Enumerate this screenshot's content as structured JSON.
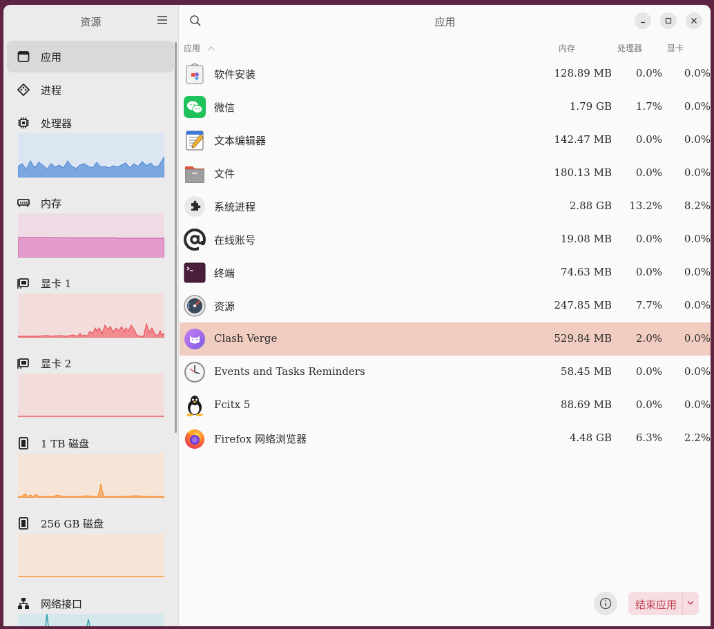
{
  "sidebar": {
    "title": "资源",
    "items": [
      {
        "label": "应用",
        "icon": "app-window-icon"
      },
      {
        "label": "进程",
        "icon": "process-icon"
      },
      {
        "label": "处理器",
        "icon": "cpu-icon"
      },
      {
        "label": "内存",
        "icon": "memory-icon"
      },
      {
        "label": "显卡 1",
        "icon": "gpu-icon"
      },
      {
        "label": "显卡 2",
        "icon": "gpu-icon"
      },
      {
        "label": "1 TB 磁盘",
        "icon": "drive-icon"
      },
      {
        "label": "256 GB 磁盘",
        "icon": "drive-icon"
      },
      {
        "label": "网络接口",
        "icon": "network-icon"
      }
    ]
  },
  "header": {
    "title": "应用"
  },
  "columns": {
    "app": "应用",
    "memory": "内存",
    "cpu": "处理器",
    "gpu": "显卡"
  },
  "apps": [
    {
      "name": "软件安装",
      "memory": "128.89 MB",
      "cpu": "0.0%",
      "gpu": "0.0%",
      "icon": "software-install-icon"
    },
    {
      "name": "微信",
      "memory": "1.79 GB",
      "cpu": "1.7%",
      "gpu": "0.0%",
      "icon": "wechat-icon"
    },
    {
      "name": "文本编辑器",
      "memory": "142.47 MB",
      "cpu": "0.0%",
      "gpu": "0.0%",
      "icon": "text-editor-icon"
    },
    {
      "name": "文件",
      "memory": "180.13 MB",
      "cpu": "0.0%",
      "gpu": "0.0%",
      "icon": "files-icon"
    },
    {
      "name": "系统进程",
      "memory": "2.88 GB",
      "cpu": "13.2%",
      "gpu": "8.2%",
      "icon": "system-process-icon"
    },
    {
      "name": "在线账号",
      "memory": "19.08 MB",
      "cpu": "0.0%",
      "gpu": "0.0%",
      "icon": "online-accounts-icon"
    },
    {
      "name": "终端",
      "memory": "74.63 MB",
      "cpu": "0.0%",
      "gpu": "0.0%",
      "icon": "terminal-icon"
    },
    {
      "name": "资源",
      "memory": "247.85 MB",
      "cpu": "7.7%",
      "gpu": "0.0%",
      "icon": "resources-icon"
    },
    {
      "name": "Clash Verge",
      "memory": "529.84 MB",
      "cpu": "2.0%",
      "gpu": "0.0%",
      "icon": "clash-verge-icon",
      "selected": true
    },
    {
      "name": "Events and Tasks Reminders",
      "memory": "58.45 MB",
      "cpu": "0.0%",
      "gpu": "0.0%",
      "icon": "clock-icon"
    },
    {
      "name": "Fcitx 5",
      "memory": "88.69 MB",
      "cpu": "0.0%",
      "gpu": "0.0%",
      "icon": "tux-icon"
    },
    {
      "name": "Firefox 网络浏览器",
      "memory": "4.48 GB",
      "cpu": "6.3%",
      "gpu": "2.2%",
      "icon": "firefox-icon"
    }
  ],
  "footer": {
    "end_label": "结束应用"
  },
  "colors": {
    "selected_row": "#f1cdc1",
    "cpu_graph": "#7aa7e0",
    "memory_graph": "#e08fc3",
    "gpu_graph": "#f07b82",
    "disk_graph": "#f5a14e",
    "network_graph": "#3aa3b3",
    "end_button": "#c13a4e"
  }
}
